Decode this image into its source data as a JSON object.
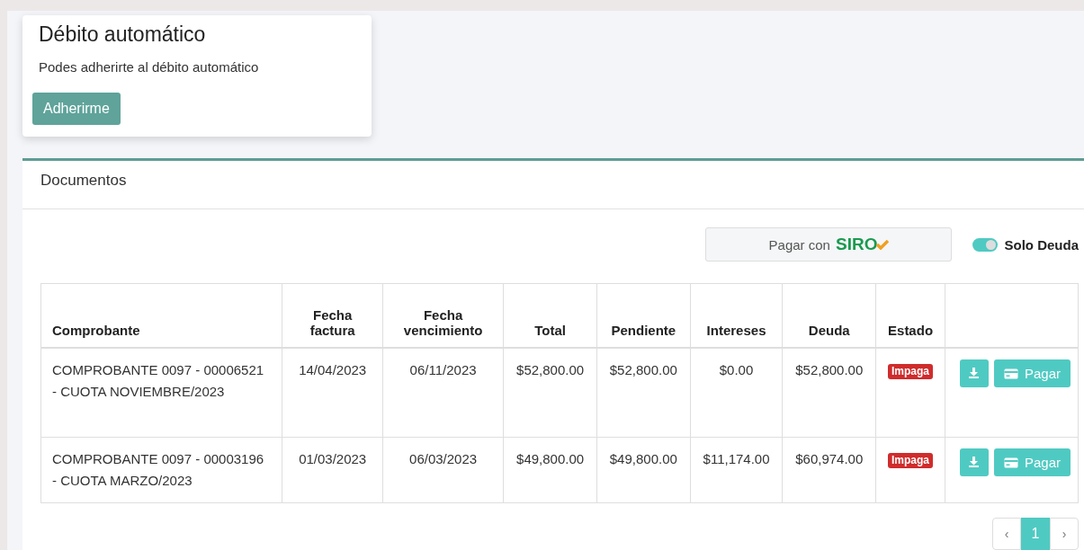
{
  "debit_card": {
    "title": "Débito automático",
    "text": "Podes adherirte al débito automático",
    "button": "Adherirme"
  },
  "documents": {
    "title": "Documentos",
    "pay_with": {
      "label": "Pagar con",
      "logo": "SIRO"
    },
    "toggle": {
      "label": "Solo Deuda",
      "on": true
    },
    "table": {
      "columns": [
        "Comprobante",
        "Fecha factura",
        "Fecha vencimiento",
        "Total",
        "Pendiente",
        "Intereses",
        "Deuda",
        "Estado"
      ],
      "rows": [
        {
          "comprobante": "COMPROBANTE 0097 - 00006521 - CUOTA NOVIEMBRE/2023",
          "fecha_factura": "14/04/2023",
          "fecha_vencimiento": "06/11/2023",
          "total": "$52,800.00",
          "pendiente": "$52,800.00",
          "intereses": "$0.00",
          "deuda": "$52,800.00",
          "estado": "Impaga",
          "pay_button": "Pagar"
        },
        {
          "comprobante": "COMPROBANTE 0097 - 00003196 - CUOTA MARZO/2023",
          "fecha_factura": "01/03/2023",
          "fecha_vencimiento": "06/03/2023",
          "total": "$49,800.00",
          "pendiente": "$49,800.00",
          "intereses": "$11,174.00",
          "deuda": "$60,974.00",
          "estado": "Impaga",
          "pay_button": "Pagar"
        }
      ]
    },
    "pagination": [
      {
        "label": "‹",
        "kind": "prev",
        "selected": false
      },
      {
        "label": "1",
        "kind": "page",
        "selected": true
      },
      {
        "label": "›",
        "kind": "next",
        "selected": false
      }
    ]
  }
}
